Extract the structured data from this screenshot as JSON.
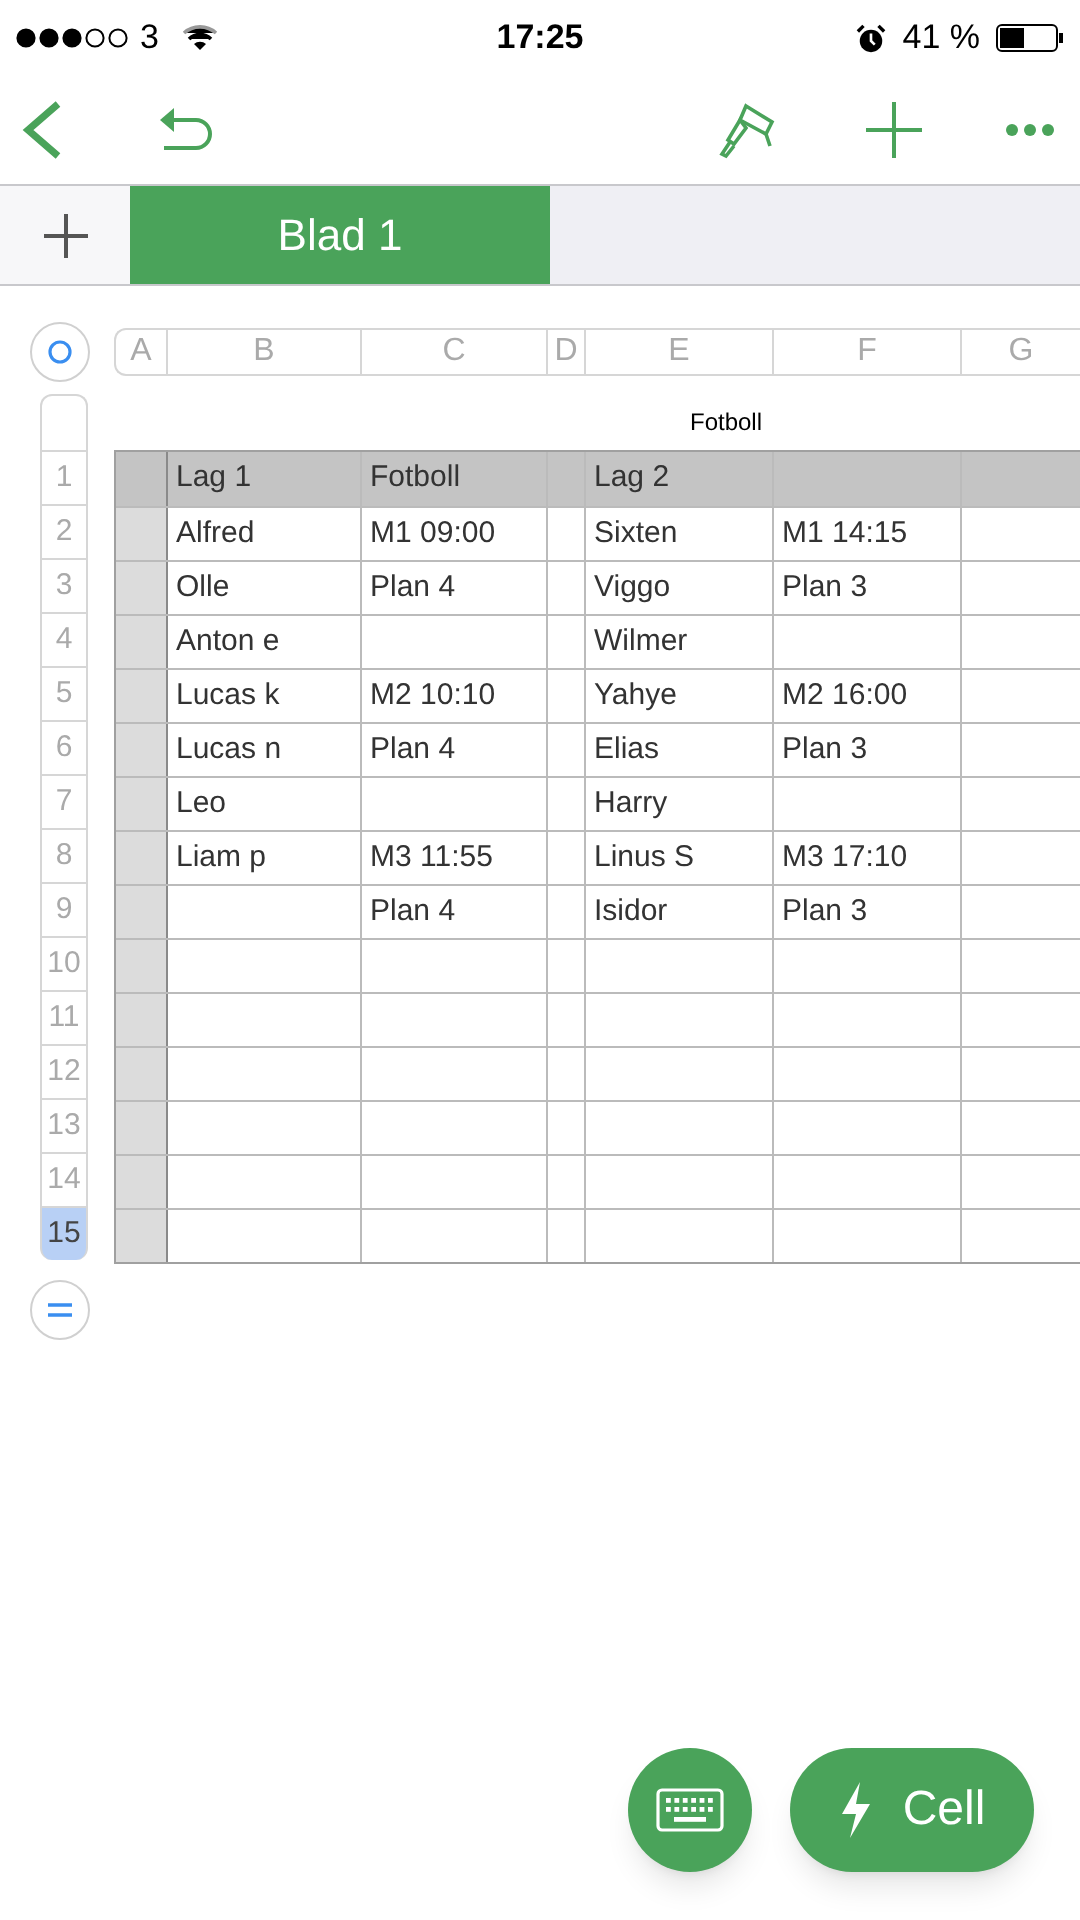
{
  "status_bar": {
    "carrier": "3",
    "time": "17:25",
    "battery": "41 %"
  },
  "tabs": [
    {
      "label": "Blad 1",
      "selected": true
    }
  ],
  "columns": [
    {
      "label": "A",
      "selected": false
    },
    {
      "label": "B",
      "selected": false
    },
    {
      "label": "C",
      "selected": false
    },
    {
      "label": "D",
      "selected": false
    },
    {
      "label": "E",
      "selected": false
    },
    {
      "label": "F",
      "selected": false
    },
    {
      "label": "G",
      "selected": false
    }
  ],
  "table": {
    "title": "Fotboll",
    "rows": [
      {
        "number": "1",
        "selected": false,
        "kind": "header",
        "cells": {
          "B": "Lag 1",
          "C": "Fotboll",
          "E": "Lag 2"
        }
      },
      {
        "number": "2",
        "selected": false,
        "kind": "body",
        "cells": {
          "B": "Alfred",
          "C": "M1 09:00",
          "E": "Sixten",
          "F": "M1 14:15"
        }
      },
      {
        "number": "3",
        "selected": false,
        "kind": "body",
        "cells": {
          "B": "Olle",
          "C": "Plan 4",
          "E": "Viggo",
          "F": "Plan 3"
        }
      },
      {
        "number": "4",
        "selected": false,
        "kind": "body",
        "cells": {
          "B": "Anton e",
          "E": "Wilmer"
        }
      },
      {
        "number": "5",
        "selected": false,
        "kind": "body",
        "cells": {
          "B": "Lucas k",
          "C": "M2 10:10",
          "E": "Yahye",
          "F": "M2 16:00"
        }
      },
      {
        "number": "6",
        "selected": false,
        "kind": "body",
        "cells": {
          "B": "Lucas n",
          "C": "Plan 4",
          "E": "Elias",
          "F": "Plan 3"
        }
      },
      {
        "number": "7",
        "selected": false,
        "kind": "body",
        "cells": {
          "B": "Leo",
          "E": "Harry"
        }
      },
      {
        "number": "8",
        "selected": false,
        "kind": "body",
        "cells": {
          "B": "Liam p",
          "C": "M3 11:55",
          "E": "Linus S",
          "F": "M3 17:10"
        }
      },
      {
        "number": "9",
        "selected": false,
        "kind": "body",
        "cells": {
          "C": "Plan 4",
          "E": "Isidor",
          "F": "Plan 3"
        }
      },
      {
        "number": "10",
        "selected": false,
        "kind": "body",
        "cells": {}
      },
      {
        "number": "11",
        "selected": false,
        "kind": "body",
        "cells": {}
      },
      {
        "number": "12",
        "selected": false,
        "kind": "body",
        "cells": {}
      },
      {
        "number": "13",
        "selected": false,
        "kind": "body",
        "cells": {}
      },
      {
        "number": "14",
        "selected": false,
        "kind": "body",
        "cells": {}
      },
      {
        "number": "15",
        "selected": true,
        "kind": "body",
        "cells": {}
      }
    ]
  },
  "cell_button": {
    "label": "Cell"
  }
}
